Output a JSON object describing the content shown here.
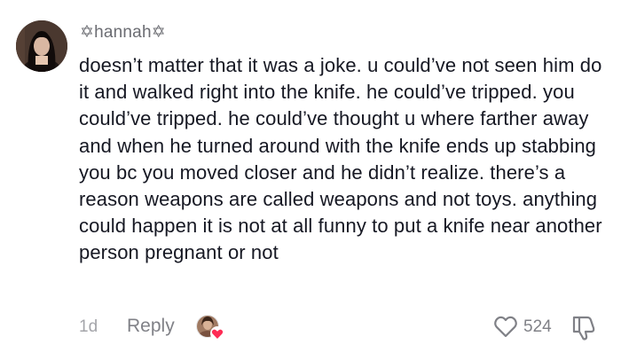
{
  "comment": {
    "username": "✡hannah✡",
    "text": "doesn’t matter that it was a joke. u could’ve not seen him do it and walked right into the knife. he could’ve tripped. you could’ve tripped. he could’ve thought u where farther away and when he turned around with the knife ends up stabbing you bc you moved closer and he didn’t realize. there’s a reason weapons are called weapons and not toys. anything could happen it is not at all funny to put a knife near another person pregnant or not",
    "time": "1d",
    "reply_label": "Reply",
    "like_count": "524",
    "icons": {
      "avatar": "user-avatar",
      "liked_by": "creator-liked-avatar",
      "like": "heart-outline-icon",
      "dislike": "thumbs-down-icon"
    },
    "colors": {
      "text": "#161823",
      "muted": "#808187",
      "heart_badge": "#fe2c55"
    }
  }
}
